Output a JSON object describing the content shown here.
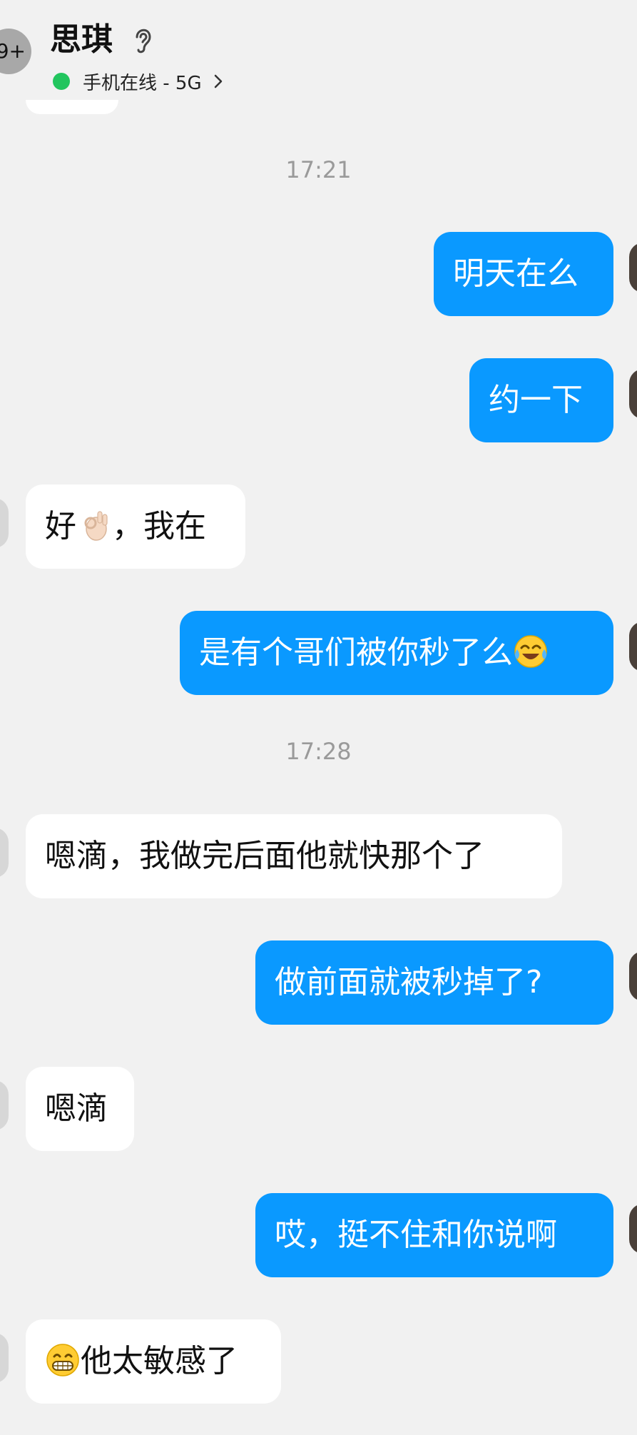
{
  "header": {
    "unread_badge": "9+",
    "contact_name": "思琪",
    "status": "手机在线 - 5G"
  },
  "messages": [
    {
      "type": "time",
      "text": "17:21"
    },
    {
      "type": "out",
      "text": "明天在么"
    },
    {
      "type": "out",
      "text": "约一下"
    },
    {
      "type": "in",
      "text_a": "好",
      "emoji": "ok-hand-emoji",
      "text_b": "，我在"
    },
    {
      "type": "out",
      "text": "是有个哥们被你秒了么",
      "emoji": "crying-laughing-emoji"
    },
    {
      "type": "time",
      "text": "17:28"
    },
    {
      "type": "in",
      "text": "嗯滴，我做完后面他就快那个了"
    },
    {
      "type": "out",
      "text": "做前面就被秒掉了?"
    },
    {
      "type": "in",
      "text": "嗯滴"
    },
    {
      "type": "out",
      "text": "哎，挺不住和你说啊"
    },
    {
      "type": "in",
      "emoji": "grinning-emoji",
      "text": "他太敏感了"
    }
  ],
  "colors": {
    "outgoing_bubble": "#0a99ff",
    "incoming_bubble": "#ffffff",
    "background": "#f1f1f1",
    "online_dot": "#22c55e"
  }
}
